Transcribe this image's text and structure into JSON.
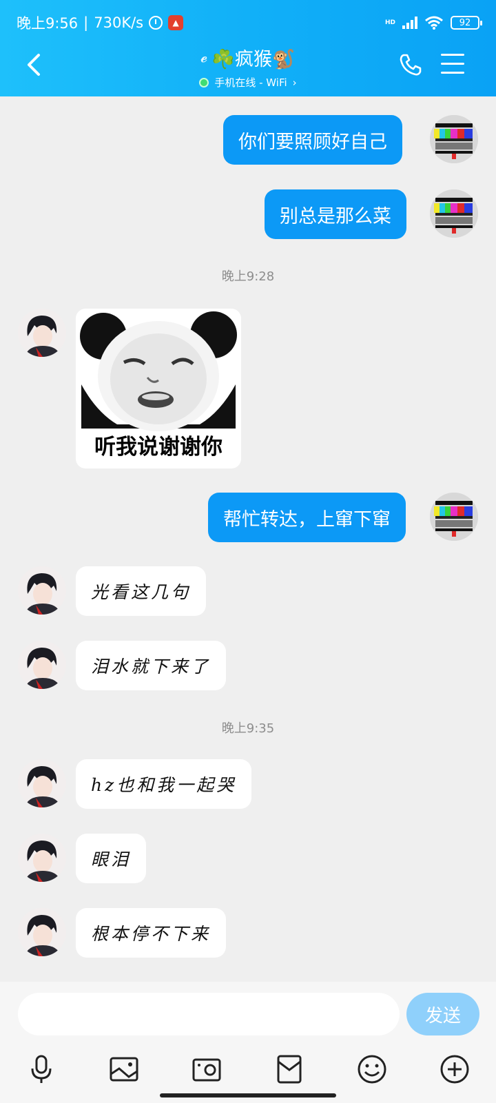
{
  "status_bar": {
    "time": "晚上9:56",
    "speed": "730K/s",
    "hd_label": "HD",
    "battery": "92"
  },
  "header": {
    "title": "☘️疯猴🐒",
    "online_status": "手机在线 - WiFi",
    "chevron": "›"
  },
  "messages": [
    {
      "side": "out",
      "text": "你们要照顾好自己"
    },
    {
      "side": "out",
      "text": "别总是那么菜"
    },
    {
      "type": "time",
      "text": "晚上9:28"
    },
    {
      "side": "in",
      "type": "sticker",
      "caption": "听我说谢谢你"
    },
    {
      "side": "out",
      "text": "帮忙转达，上窜下窜"
    },
    {
      "side": "in",
      "text": "光看这几句"
    },
    {
      "side": "in",
      "text": "泪水就下来了"
    },
    {
      "type": "time",
      "text": "晚上9:35"
    },
    {
      "side": "in",
      "text": "hz也和我一起哭"
    },
    {
      "side": "in",
      "text": "眼泪"
    },
    {
      "side": "in",
      "text": "根本停不下来"
    }
  ],
  "input": {
    "placeholder": "",
    "send_label": "发送"
  },
  "toolbar": {
    "icons": [
      "microphone-icon",
      "image-icon",
      "camera-icon",
      "red-packet-icon",
      "emoji-icon",
      "plus-icon"
    ]
  },
  "colors": {
    "header_start": "#1ec0fb",
    "header_end": "#0aa2f5",
    "outgoing_bubble": "#0c99f6",
    "send_button": "#8fd0fb"
  }
}
